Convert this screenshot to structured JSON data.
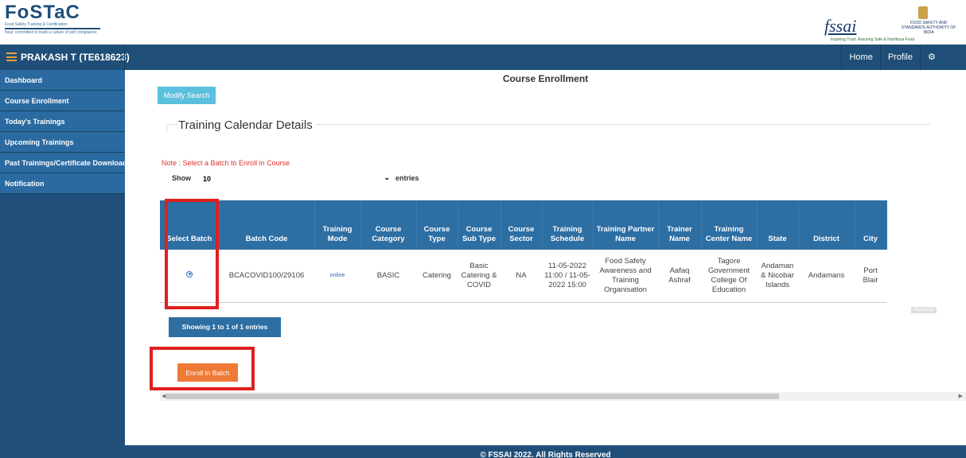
{
  "header": {
    "logo_text": "FoSTaC",
    "logo_subtitle": "Food Safety Training & Certification",
    "logo_tagline": "fssai: committed to build a culture of self compliance",
    "fssai_text": "fssai",
    "fssai_authority": "FOOD SAFETY AND STANDARDS AUTHORITY OF INDIA",
    "fssai_slogan": "Inspiring Trust, Assuring Safe & Nutritious Food"
  },
  "navbar": {
    "username": "PRAKASH T (TE618623)",
    "home": "Home",
    "profile": "Profile",
    "help": "⚙ Help? ▾"
  },
  "sidebar": {
    "items": [
      {
        "label": "Dashboard"
      },
      {
        "label": "Course Enrollment"
      },
      {
        "label": "Today's Trainings"
      },
      {
        "label": "Upcoming Trainings"
      },
      {
        "label": "Past Trainings/Certificate Download"
      },
      {
        "label": "Notification"
      }
    ]
  },
  "main": {
    "title": "Course Enrollment",
    "modify_search": "Modify Search",
    "legend": "Training Calendar Details",
    "note": "Note : Select a Batch to Enroll in Course",
    "show_label": "Show",
    "show_value": "10",
    "entries_label": "entries",
    "showing": "Showing 1 to 1 of 1 entries",
    "enroll_button": "Enroll In Batch",
    "recharge": "Recharge"
  },
  "table": {
    "headers": [
      "Select Batch",
      "Batch Code",
      "Training Mode",
      "Course Category",
      "Course Type",
      "Course Sub Type",
      "Course Sector",
      "Training Schedule",
      "Training Partner Name",
      "Trainer Name",
      "Training Center Name",
      "State",
      "District",
      "City"
    ],
    "row": {
      "batch_code": "BCACOVID100/29106",
      "mode": "online",
      "category": "BASIC",
      "type": "Catering",
      "sub_type": "Basic Catering & COVID",
      "sector": "NA",
      "schedule": "11-05-2022 11:00 / 11-05-2022 15:00",
      "partner": "Food Safety Awareness and Training Organisation",
      "trainer": "Aafaq Ashraf",
      "center": "Tagore Government College Of Education",
      "state": "Andaman & Nicobar Islands",
      "district": "Andamans",
      "city": "Port Blair"
    }
  },
  "footer": {
    "text": "© FSSAI 2022. All Rights Reserved"
  }
}
